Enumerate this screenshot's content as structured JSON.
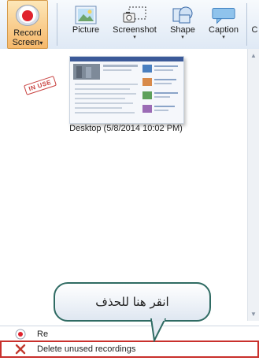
{
  "ribbon": {
    "record": {
      "label_line1": "Record",
      "label_line2": "Screen",
      "caret": "▾"
    },
    "buttons": [
      {
        "label": "Picture",
        "icon": "picture-icon",
        "caret": ""
      },
      {
        "label": "Screenshot",
        "icon": "screenshot-icon",
        "caret": "▾"
      },
      {
        "label": "Shape",
        "icon": "shape-icon",
        "caret": "▾"
      },
      {
        "label": "Caption",
        "icon": "caption-icon",
        "caret": "▾"
      },
      {
        "label": "C",
        "icon": "",
        "caret": ""
      }
    ]
  },
  "recording": {
    "stamp": "IN USE",
    "caption": "Desktop (5/8/2014 10:02 PM)"
  },
  "bottom_list": {
    "record_row_label": "Re",
    "delete_row_label": "Delete unused recordings"
  },
  "callout": {
    "text": "انقر هنا للحذف"
  },
  "colors": {
    "accent": "#e0222d",
    "highlight": "#c9302c",
    "callout_border": "#2f6b63"
  }
}
